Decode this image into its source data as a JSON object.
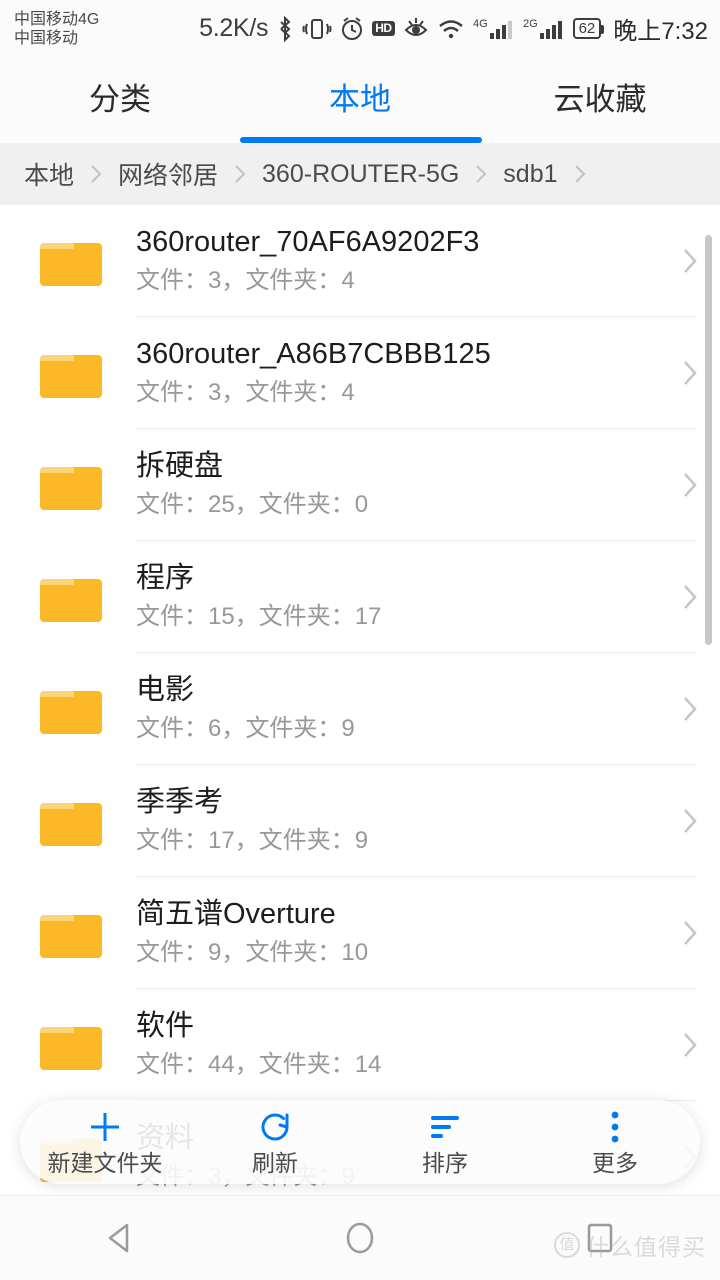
{
  "status_bar": {
    "carrier_line1": "中国移动4G",
    "carrier_line2": "中国移动",
    "net_speed": "5.2K/s",
    "hd_badge": "HD",
    "signal1_label": "4G",
    "signal2_label": "2G",
    "battery_percent": "62",
    "clock": "晚上7:32",
    "icons": [
      "bluetooth-icon",
      "vibrate-icon",
      "alarm-icon",
      "hd-icon",
      "eye-care-icon",
      "wifi-icon",
      "signal-4g-icon",
      "signal-2g-icon",
      "battery-icon"
    ]
  },
  "tabs": [
    {
      "label": "分类",
      "active": false
    },
    {
      "label": "本地",
      "active": true
    },
    {
      "label": "云收藏",
      "active": false
    }
  ],
  "breadcrumb": {
    "separator": "›",
    "items": [
      "本地",
      "网络邻居",
      "360-ROUTER-5G",
      "sdb1"
    ]
  },
  "list": {
    "meta_prefix": "文件：",
    "meta_mid": "，文件夹：",
    "rows": [
      {
        "name": "360router_70AF6A9202F3",
        "files": "3",
        "folders": "4",
        "meta": "文件：3，文件夹：4"
      },
      {
        "name": "360router_A86B7CBBB125",
        "files": "3",
        "folders": "4",
        "meta": "文件：3，文件夹：4"
      },
      {
        "name": "拆硬盘",
        "files": "25",
        "folders": "0",
        "meta": "文件：25，文件夹：0"
      },
      {
        "name": "程序",
        "files": "15",
        "folders": "17",
        "meta": "文件：15，文件夹：17"
      },
      {
        "name": "电影",
        "files": "6",
        "folders": "9",
        "meta": "文件：6，文件夹：9"
      },
      {
        "name": "季季考",
        "files": "17",
        "folders": "9",
        "meta": "文件：17，文件夹：9"
      },
      {
        "name": "简五谱Overture",
        "files": "9",
        "folders": "10",
        "meta": "文件：9，文件夹：10"
      },
      {
        "name": "软件",
        "files": "44",
        "folders": "14",
        "meta": "文件：44，文件夹：14"
      },
      {
        "name": "资料",
        "files": "3",
        "folders": "9",
        "meta": "文件：3，文件夹：9"
      }
    ]
  },
  "toolbar": {
    "new_folder_label": "新建文件夹",
    "refresh_label": "刷新",
    "sort_label": "排序",
    "more_label": "更多"
  },
  "navigation": {
    "back_label": "返回",
    "home_label": "主页",
    "recents_label": "最近任务"
  },
  "watermark": {
    "mark": "值",
    "text": "什么值得买"
  },
  "colors": {
    "accent": "#007af0",
    "folder": "#fdb827",
    "folder_tab": "#fcd579",
    "text_primary": "#1d1d1d",
    "text_secondary": "#989898",
    "breadcrumb_bg": "#f0f0f0"
  }
}
